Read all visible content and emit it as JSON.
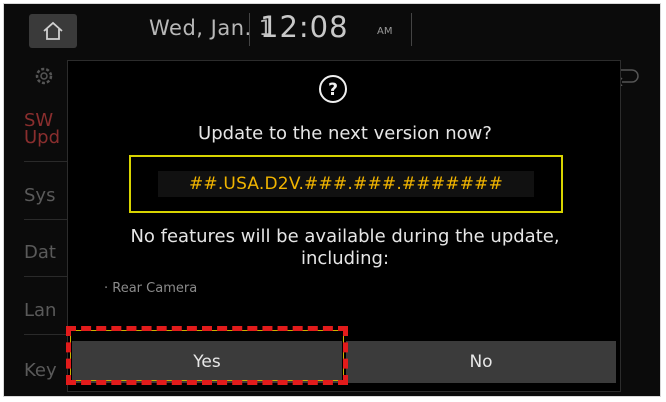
{
  "status_bar": {
    "date": "Wed, Jan. 1",
    "time": "12:08",
    "ampm": "AM",
    "home_icon": "home-icon"
  },
  "background_menu": {
    "items": [
      {
        "label": "SW\nUpd",
        "active": true
      },
      {
        "label": "Sys",
        "active": false
      },
      {
        "label": "Dat",
        "active": false
      },
      {
        "label": "Lan",
        "active": false
      },
      {
        "label": "Key",
        "active": false
      }
    ],
    "settings_icon": "gear-icon",
    "back_icon": "back-arrow-icon"
  },
  "dialog": {
    "icon": "help-icon",
    "title": "Update to the next version now?",
    "version": "##.USA.D2V.###.###.#######",
    "warning_line1": "No features will be available during the update,",
    "warning_line2": "including:",
    "feature": "·  Rear Camera",
    "yes_label": "Yes",
    "no_label": "No"
  },
  "colors": {
    "highlight": "#e21b1b",
    "version_frame": "#d8d400",
    "version_text": "#f0b400"
  }
}
